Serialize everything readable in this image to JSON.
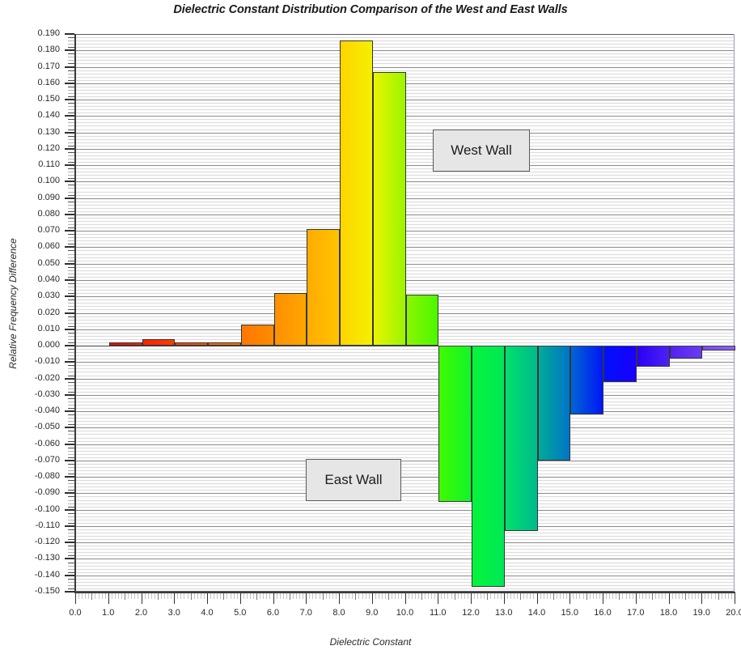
{
  "chart_data": {
    "type": "bar",
    "title": "Dielectric Constant Distribution Comparison of the West and East Walls",
    "xlabel": "Dielectric Constant",
    "ylabel": "Relative Frequency Difference",
    "xlim": [
      0.0,
      20.0
    ],
    "ylim": [
      -0.15,
      0.19
    ],
    "grid": true,
    "legend_position": "inside-annotations",
    "x_ticks": [
      "0.0",
      "1.0",
      "2.0",
      "3.0",
      "4.0",
      "5.0",
      "6.0",
      "7.0",
      "8.0",
      "9.0",
      "10.0",
      "11.0",
      "12.0",
      "13.0",
      "14.0",
      "15.0",
      "16.0",
      "17.0",
      "18.0",
      "19.0",
      "20.0"
    ],
    "x_tick_values": [
      0,
      1,
      2,
      3,
      4,
      5,
      6,
      7,
      8,
      9,
      10,
      11,
      12,
      13,
      14,
      15,
      16,
      17,
      18,
      19,
      20
    ],
    "y_ticks": [
      "0.190",
      "0.180",
      "0.170",
      "0.160",
      "0.150",
      "0.140",
      "0.130",
      "0.120",
      "0.110",
      "0.100",
      "0.090",
      "0.080",
      "0.070",
      "0.060",
      "0.050",
      "0.040",
      "0.030",
      "0.020",
      "0.010",
      "0.000",
      "-0.010",
      "-0.020",
      "-0.030",
      "-0.040",
      "-0.050",
      "-0.060",
      "-0.070",
      "-0.080",
      "-0.090",
      "-0.100",
      "-0.110",
      "-0.120",
      "-0.130",
      "-0.140",
      "-0.150"
    ],
    "y_tick_values": [
      0.19,
      0.18,
      0.17,
      0.16,
      0.15,
      0.14,
      0.13,
      0.12,
      0.11,
      0.1,
      0.09,
      0.08,
      0.07,
      0.06,
      0.05,
      0.04,
      0.03,
      0.02,
      0.01,
      0.0,
      -0.01,
      -0.02,
      -0.03,
      -0.04,
      -0.05,
      -0.06,
      -0.07,
      -0.08,
      -0.09,
      -0.1,
      -0.11,
      -0.12,
      -0.13,
      -0.14,
      -0.15
    ],
    "y_tick_minor_step": 0.002,
    "bar_width": 1.0,
    "bars": [
      {
        "bin_start": 1.0,
        "bin_end": 2.0,
        "value": 0.002,
        "color_left": "#ff0000",
        "color_right": "#ff2200"
      },
      {
        "bin_start": 2.0,
        "bin_end": 3.0,
        "value": 0.004,
        "color_left": "#ff2200",
        "color_right": "#ff3c00"
      },
      {
        "bin_start": 3.0,
        "bin_end": 4.0,
        "value": 0.002,
        "color_left": "#ff4400",
        "color_right": "#ff5a00"
      },
      {
        "bin_start": 4.0,
        "bin_end": 5.0,
        "value": 0.002,
        "color_left": "#ff6600",
        "color_right": "#ff7300"
      },
      {
        "bin_start": 5.0,
        "bin_end": 6.0,
        "value": 0.013,
        "color_left": "#ff7700",
        "color_right": "#ff8c00"
      },
      {
        "bin_start": 6.0,
        "bin_end": 7.0,
        "value": 0.032,
        "color_left": "#ff9000",
        "color_right": "#ffa600"
      },
      {
        "bin_start": 7.0,
        "bin_end": 8.0,
        "value": 0.071,
        "color_left": "#ffab00",
        "color_right": "#ffc400"
      },
      {
        "bin_start": 8.0,
        "bin_end": 9.0,
        "value": 0.186,
        "color_left": "#ffd400",
        "color_right": "#f4f000"
      },
      {
        "bin_start": 9.0,
        "bin_end": 10.0,
        "value": 0.167,
        "color_left": "#eaf400",
        "color_right": "#9bf500"
      },
      {
        "bin_start": 10.0,
        "bin_end": 11.0,
        "value": 0.031,
        "color_left": "#8cf500",
        "color_right": "#4cf800"
      },
      {
        "bin_start": 11.0,
        "bin_end": 12.0,
        "value": -0.095,
        "color_left": "#40fa00",
        "color_right": "#10f52a"
      },
      {
        "bin_start": 12.0,
        "bin_end": 13.0,
        "value": -0.147,
        "color_left": "#06f43a",
        "color_right": "#00e858"
      },
      {
        "bin_start": 13.0,
        "bin_end": 14.0,
        "value": -0.113,
        "color_left": "#00e06a",
        "color_right": "#00b98c"
      },
      {
        "bin_start": 14.0,
        "bin_end": 15.0,
        "value": -0.07,
        "color_left": "#00ac97",
        "color_right": "#0073c8"
      },
      {
        "bin_start": 15.0,
        "bin_end": 16.0,
        "value": -0.042,
        "color_left": "#0066d4",
        "color_right": "#0016f8"
      },
      {
        "bin_start": 16.0,
        "bin_end": 17.0,
        "value": -0.022,
        "color_left": "#0010fa",
        "color_right": "#1a00ff"
      },
      {
        "bin_start": 17.0,
        "bin_end": 18.0,
        "value": -0.013,
        "color_left": "#2a00f8",
        "color_right": "#4c22f2"
      },
      {
        "bin_start": 18.0,
        "bin_end": 19.0,
        "value": -0.008,
        "color_left": "#5222f0",
        "color_right": "#6a3cf0"
      },
      {
        "bin_start": 19.0,
        "bin_end": 20.0,
        "value": -0.003,
        "color_left": "#7a4cf2",
        "color_right": "#8c5ef5"
      }
    ],
    "annotations": [
      {
        "label": "West Wall",
        "x": 13.2,
        "y": 0.122
      },
      {
        "label": "East Wall",
        "x": 9.5,
        "y": -0.078
      }
    ]
  }
}
